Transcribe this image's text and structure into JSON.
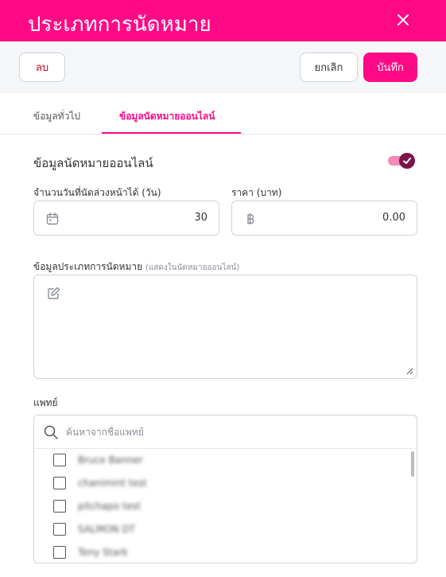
{
  "header": {
    "title": "ประเภทการนัดหมาย"
  },
  "toolbar": {
    "delete_label": "ลบ",
    "cancel_label": "ยกเลิก",
    "save_label": "บันทึก"
  },
  "tabs": [
    {
      "label": "ข้อมูลทั่วไป",
      "active": false
    },
    {
      "label": "ข้อมูลนัดหมายออนไลน์",
      "active": true
    }
  ],
  "online": {
    "section_title": "ข้อมูลนัดหมายออนไลน์",
    "enabled": true,
    "advance_days_label": "จำนวนวันที่นัดล่วงหน้าได้ (วัน)",
    "advance_days_value": "30",
    "price_label": "ราคา (บาท)",
    "price_value": "0.00",
    "description_label": "ข้อมูลประเภทการนัดหมาย",
    "description_hint": "(แสดงในนัดหมายออนไลน์)",
    "description_value": ""
  },
  "doctors": {
    "label": "แพทย์",
    "search_placeholder": "ค้นหาจากชื่อแพทย์",
    "items": [
      {
        "name": "Bruce Banner",
        "checked": false
      },
      {
        "name": "chanimint test",
        "checked": false
      },
      {
        "name": "pitchapo test",
        "checked": false
      },
      {
        "name": "SALMON DT",
        "checked": false
      },
      {
        "name": "Tony Stark",
        "checked": false
      }
    ]
  },
  "colors": {
    "brand": "#ff0a86",
    "toggle_knob": "#7a1449",
    "danger": "#d0021b"
  }
}
